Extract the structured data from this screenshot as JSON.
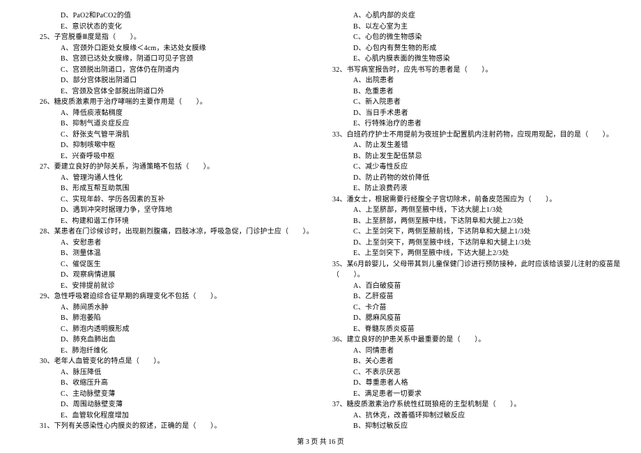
{
  "footer": "第 3 页 共 16 页",
  "left_column": [
    {
      "type": "option",
      "text": "D、PaO2和PaCO2的值"
    },
    {
      "type": "option",
      "text": "E、意识状态的变化"
    },
    {
      "type": "question",
      "text": "25、子宫脱垂Ⅲ度是指（　　）。"
    },
    {
      "type": "option",
      "text": "A、宫颈外口距处女膜缘＜4cm，未达处女膜缘"
    },
    {
      "type": "option",
      "text": "B、宫颈已达处女膜缘，阴道口可见子宫颈"
    },
    {
      "type": "option",
      "text": "C、宫颈脱出阴道口，宫体仍在阴道内"
    },
    {
      "type": "option",
      "text": "D、部分宫体脱出阴道口"
    },
    {
      "type": "option",
      "text": "E、宫颈及宫体全部脱出阴道口外"
    },
    {
      "type": "question",
      "text": "26、糖皮质激素用于治疗哮喘的主要作用是（　　）。"
    },
    {
      "type": "option",
      "text": "A、降低痰液黏稠度"
    },
    {
      "type": "option",
      "text": "B、抑制气道炎症反应"
    },
    {
      "type": "option",
      "text": "C、舒张支气管平滑肌"
    },
    {
      "type": "option",
      "text": "D、抑制咳嗽中枢"
    },
    {
      "type": "option",
      "text": "E、兴奋呼吸中枢"
    },
    {
      "type": "question",
      "text": "27、要建立良好的护际关系，沟通策略不包括（　　）。"
    },
    {
      "type": "option",
      "text": "A、管理沟通人性化"
    },
    {
      "type": "option",
      "text": "B、形成互帮互助氛围"
    },
    {
      "type": "option",
      "text": "C、实现年龄、学历各因素的互补"
    },
    {
      "type": "option",
      "text": "D、遇到冲突时据理力争，坚守阵地"
    },
    {
      "type": "option",
      "text": "E、构建和谐工作环境"
    },
    {
      "type": "question",
      "text": "28、某患者在门诊候诊时，出现剧烈腹痛，四肢冰凉，呼吸急促，门诊护士应（　　）。"
    },
    {
      "type": "option",
      "text": "A、安慰患者"
    },
    {
      "type": "option",
      "text": "B、测量体温"
    },
    {
      "type": "option",
      "text": "C、催促医生"
    },
    {
      "type": "option",
      "text": "D、观察病情进展"
    },
    {
      "type": "option",
      "text": "E、安排提前就诊"
    },
    {
      "type": "question",
      "text": "29、急性呼吸窘迫综合征早期的病理变化不包括（　　）。"
    },
    {
      "type": "option",
      "text": "A、肺间质水肿"
    },
    {
      "type": "option",
      "text": "B、肺泡萎陷"
    },
    {
      "type": "option",
      "text": "C、肺泡内透明膜形成"
    },
    {
      "type": "option",
      "text": "D、肺充血肺出血"
    },
    {
      "type": "option",
      "text": "E、肺泡纤维化"
    },
    {
      "type": "question",
      "text": "30、老年人血管变化的特点是（　　）。"
    },
    {
      "type": "option",
      "text": "A、脉压降低"
    },
    {
      "type": "option",
      "text": "B、收缩压升高"
    },
    {
      "type": "option",
      "text": "C、主动脉壁变薄"
    },
    {
      "type": "option",
      "text": "D、周围动脉壁变薄"
    },
    {
      "type": "option",
      "text": "E、血管软化程度增加"
    },
    {
      "type": "question",
      "text": "31、下列有关感染性心内膜炎的叙述，正确的是（　　）。"
    }
  ],
  "right_column": [
    {
      "type": "option",
      "text": "A、心肌内部的炎症"
    },
    {
      "type": "option",
      "text": "B、以左心室为主"
    },
    {
      "type": "option",
      "text": "C、心包的微生物感染"
    },
    {
      "type": "option",
      "text": "D、心包内有赘生物的形成"
    },
    {
      "type": "option",
      "text": "E、心肌内膜表面的微生物感染"
    },
    {
      "type": "question",
      "text": "32、书写病室报告时，应先书写的患者是（　　）。"
    },
    {
      "type": "option",
      "text": "A、出院患者"
    },
    {
      "type": "option",
      "text": "B、危重患者"
    },
    {
      "type": "option",
      "text": "C、新入院患者"
    },
    {
      "type": "option",
      "text": "D、当日手术患者"
    },
    {
      "type": "option",
      "text": "E、行特殊治疗的患者"
    },
    {
      "type": "question",
      "text": "33、白班药疗护士不用提前为夜班护士配置肌内注射药物，应现用现配，目的是（　　）。"
    },
    {
      "type": "option",
      "text": "A、防止发生差错"
    },
    {
      "type": "option",
      "text": "B、防止发生配伍禁忌"
    },
    {
      "type": "option",
      "text": "C、减少毒性反应"
    },
    {
      "type": "option",
      "text": "D、防止药物的效价降低"
    },
    {
      "type": "option",
      "text": "E、防止浪费药液"
    },
    {
      "type": "question",
      "text": "34、潘女士，根据需要行经腹全子宫切除术，前备皮范围应为（　　）。"
    },
    {
      "type": "option",
      "text": "A、上至脐部，两侧至腋中线，下达大腿上1/3处"
    },
    {
      "type": "option",
      "text": "B、上至脐部，两侧至腋中线，下达阴阜和大腿上2/3处"
    },
    {
      "type": "option",
      "text": "C、上至剑突下，两侧至腋前线，下达阴阜和大腿上1/3处"
    },
    {
      "type": "option",
      "text": "D、上至剑突下，两侧至腋中线，下达阴阜和大腿上1/3处"
    },
    {
      "type": "option",
      "text": "E、上至剑突下，两侧至腋中线，下达大腿上2/3处"
    },
    {
      "type": "question",
      "text": "35、某6月龄婴儿，父母带其到儿童保健门诊进行预防接种，此时应该给该婴儿注射的疫苗是"
    },
    {
      "type": "question",
      "text": "（　　）。"
    },
    {
      "type": "option",
      "text": "A、百白破疫苗"
    },
    {
      "type": "option",
      "text": "B、乙肝疫苗"
    },
    {
      "type": "option",
      "text": "C、卡介苗"
    },
    {
      "type": "option",
      "text": "D、腮麻风疫苗"
    },
    {
      "type": "option",
      "text": "E、脊髓灰质炎疫苗"
    },
    {
      "type": "question",
      "text": "36、建立良好的护患关系中最重要的是（　　）。"
    },
    {
      "type": "option",
      "text": "A、同情患者"
    },
    {
      "type": "option",
      "text": "B、关心患者"
    },
    {
      "type": "option",
      "text": "C、不表示厌恶"
    },
    {
      "type": "option",
      "text": "D、尊重患者人格"
    },
    {
      "type": "option",
      "text": "E、满足患者一切要求"
    },
    {
      "type": "question",
      "text": "37、糖皮质激素治疗系统性红斑狼疮的主型机制是（　　）。"
    },
    {
      "type": "option",
      "text": "A、抗休克，改善循环抑制过敏反应"
    },
    {
      "type": "option",
      "text": "B、抑制过敏反应"
    }
  ]
}
